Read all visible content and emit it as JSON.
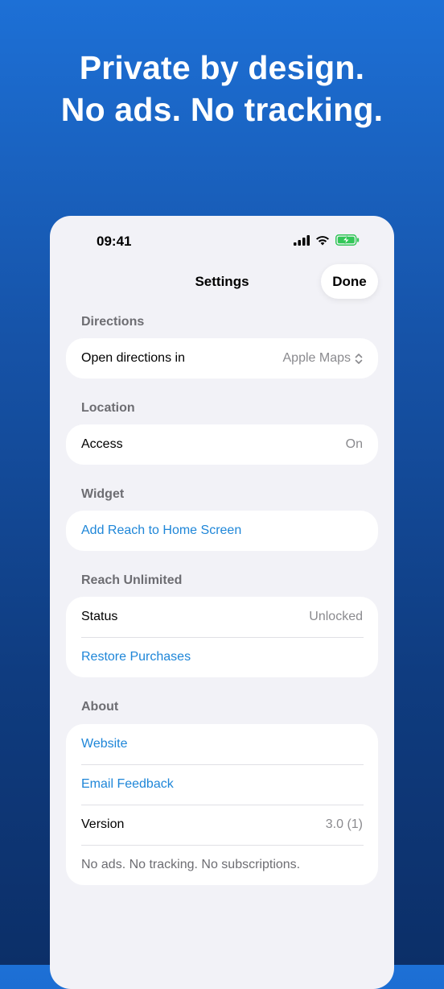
{
  "headline": {
    "line1": "Private by design.",
    "line2": "No ads. No tracking."
  },
  "status_bar": {
    "time": "09:41"
  },
  "nav": {
    "title": "Settings",
    "done_label": "Done"
  },
  "sections": {
    "directions": {
      "header": "Directions",
      "open_in_label": "Open directions in",
      "open_in_value": "Apple Maps"
    },
    "location": {
      "header": "Location",
      "access_label": "Access",
      "access_value": "On"
    },
    "widget": {
      "header": "Widget",
      "add_label": "Add Reach to Home Screen"
    },
    "reach_unlimited": {
      "header": "Reach Unlimited",
      "status_label": "Status",
      "status_value": "Unlocked",
      "restore_label": "Restore Purchases"
    },
    "about": {
      "header": "About",
      "website_label": "Website",
      "feedback_label": "Email Feedback",
      "version_label": "Version",
      "version_value": "3.0 (1)",
      "footnote": "No ads. No tracking. No subscriptions."
    }
  },
  "colors": {
    "link": "#1e86d8",
    "battery": "#34c759",
    "background_top": "#1d70d6",
    "background_bottom": "#0c2f68"
  },
  "icons": {
    "signal": "cellular-signal-icon",
    "wifi": "wifi-icon",
    "battery": "battery-charging-icon",
    "selector": "chevron-up-down-icon"
  }
}
